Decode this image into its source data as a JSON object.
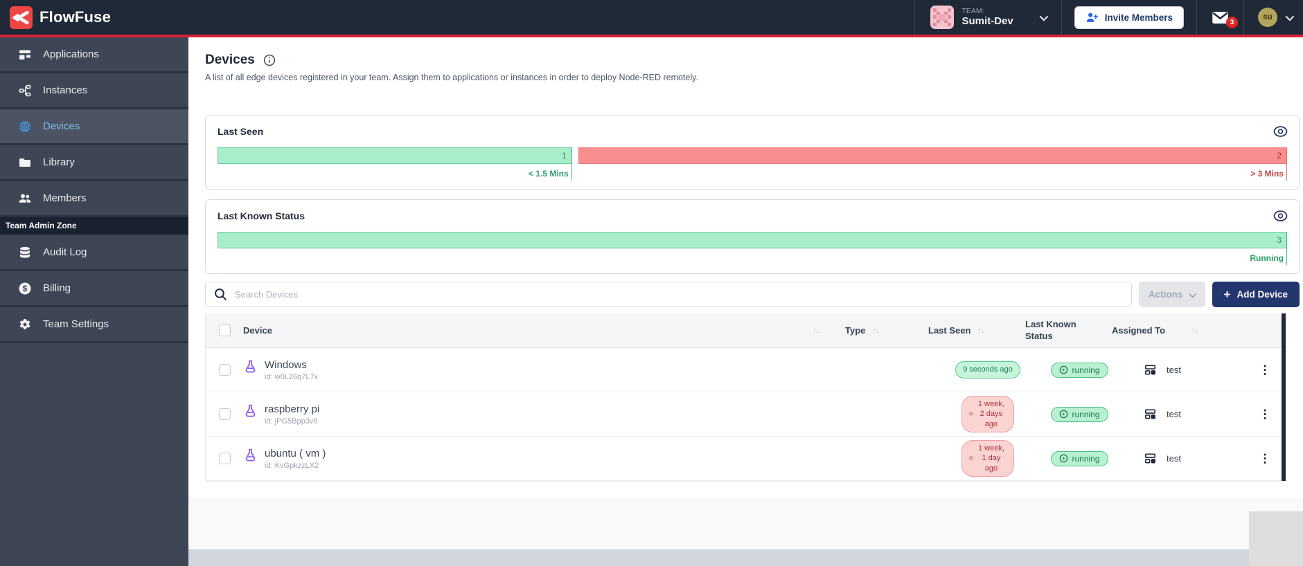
{
  "navbar": {
    "logo_text": "FlowFuse",
    "team_label": "TEAM:",
    "team_name": "Sumit-Dev",
    "invite_members_label": "Invite Members",
    "notification_count": "3",
    "user_initials": "su"
  },
  "sidebar": {
    "items": [
      {
        "label": "Applications"
      },
      {
        "label": "Instances"
      },
      {
        "label": "Devices"
      },
      {
        "label": "Library"
      },
      {
        "label": "Members"
      }
    ],
    "admin_zone_label": "Team Admin Zone",
    "admin_items": [
      {
        "label": "Audit Log"
      },
      {
        "label": "Billing"
      },
      {
        "label": "Team Settings"
      }
    ]
  },
  "page": {
    "title": "Devices",
    "description": "A list of all edge devices registered in your team. Assign them to applications or instances in order to deploy Node-RED remotely."
  },
  "panels": {
    "last_seen": {
      "title": "Last Seen",
      "segments": [
        {
          "value": "1",
          "label": "< 1.5 Mins",
          "state": "ok"
        },
        {
          "value": "2",
          "label": "> 3 Mins",
          "state": "error"
        }
      ]
    },
    "last_known_status": {
      "title": "Last Known Status",
      "segments": [
        {
          "value": "3",
          "label": "Running",
          "state": "ok"
        }
      ]
    }
  },
  "toolbar": {
    "search_placeholder": "Search Devices",
    "actions_label": "Actions",
    "add_device_label": "Add Device"
  },
  "table": {
    "headers": {
      "device": "Device",
      "type": "Type",
      "last_seen": "Last Seen",
      "last_known_status": "Last Known Status",
      "assigned_to": "Assigned To"
    },
    "rows": [
      {
        "name": "Windows",
        "device_id": "id: w0L26q7L7x",
        "last_seen": "9 seconds ago",
        "last_seen_state": "ok",
        "status": "running",
        "assigned_to": "test"
      },
      {
        "name": "raspberry pi",
        "device_id": "id: jPG5Bpp3v8",
        "last_seen": "1 week, 2 days ago",
        "last_seen_state": "stale",
        "status": "running",
        "assigned_to": "test"
      },
      {
        "name": "ubuntu ( vm )",
        "device_id": "id: KvGpkzzLX2",
        "last_seen": "1 week, 1 day ago",
        "last_seen_state": "stale",
        "status": "running",
        "assigned_to": "test"
      }
    ]
  },
  "icons": {
    "sort": "↑↓",
    "kebab": "⋮",
    "plus": "+"
  },
  "colors": {
    "navbar_bg": "#1f2937",
    "accent_red": "#d92139",
    "sidebar_bg": "#3e4655",
    "primary_button": "#23366e",
    "success_fill": "#a9edca",
    "danger_fill": "#f98e8e"
  }
}
